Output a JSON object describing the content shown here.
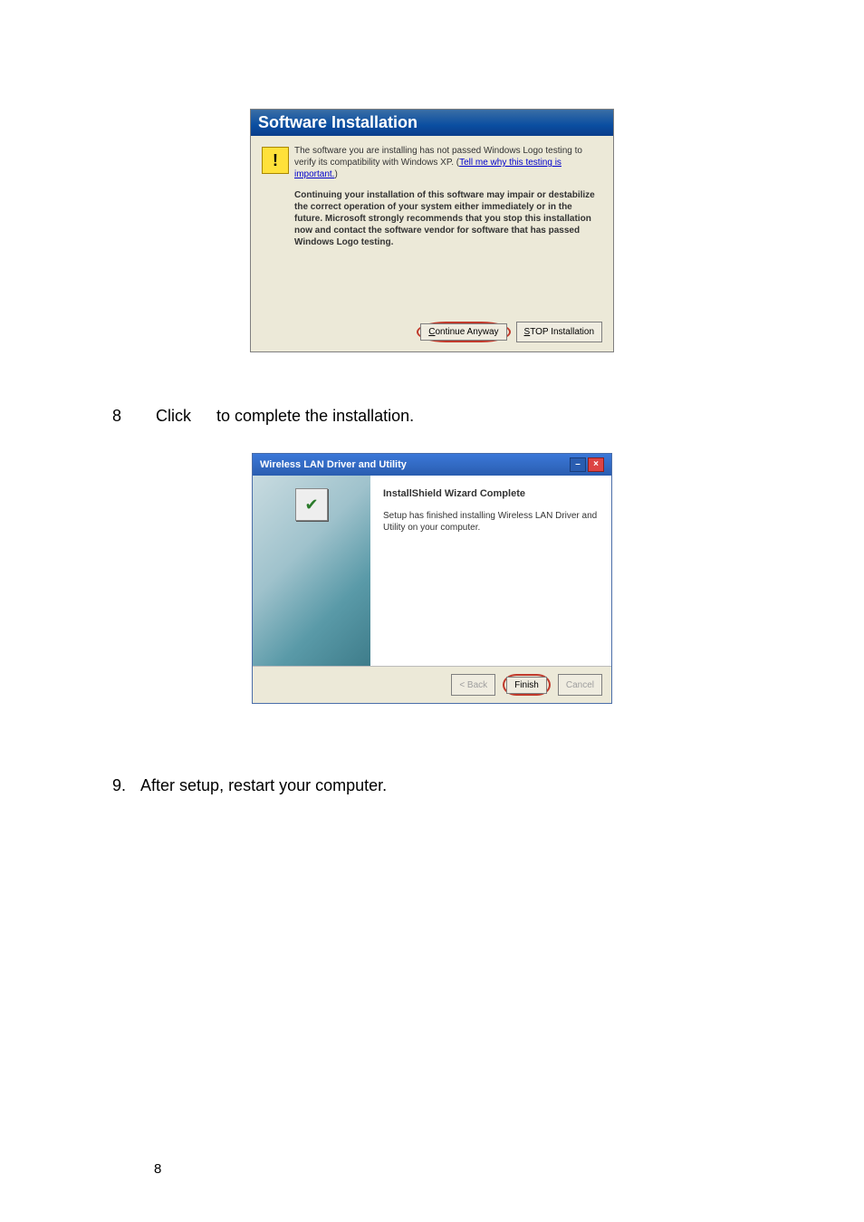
{
  "dialog1": {
    "title": "Software Installation",
    "warn_glyph": "!",
    "para1_part1": "The software you are installing has not passed Windows Logo testing to verify its compatibility with Windows XP. (",
    "para1_link": "Tell me why this testing is important.",
    "para1_part2": ")",
    "para2": "Continuing your installation of this software may impair or destabilize the correct operation of your system either immediately or in the future. Microsoft strongly recommends that you stop this installation now and contact the software vendor for software that has passed Windows Logo testing.",
    "continue_btn_u": "C",
    "continue_btn_rest": "ontinue Anyway",
    "stop_btn_u": "S",
    "stop_btn_rest": "TOP Installation"
  },
  "step8": {
    "num": "8",
    "text_before": "Click",
    "text_after": "to complete the installation."
  },
  "dialog2": {
    "title": "Wireless LAN Driver and Utility",
    "sidebar_icon_glyph": "✔",
    "heading": "InstallShield Wizard Complete",
    "body": "Setup has finished installing  Wireless LAN Driver and Utility on your computer.",
    "btn_back": "< Back",
    "btn_finish": "Finish",
    "btn_cancel": "Cancel"
  },
  "step9": {
    "num": "9.",
    "text": "After setup, restart your computer."
  },
  "page_number": "8"
}
